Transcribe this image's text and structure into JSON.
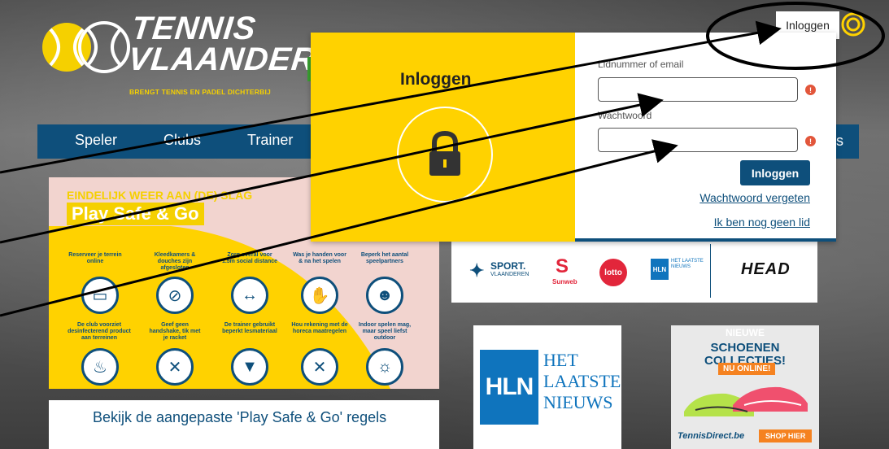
{
  "site": {
    "logo_line1": "TENNIS",
    "logo_line2": "VLAANDEREN",
    "tagline": "BRENGT TENNIS EN PADEL DICHTERBIJ"
  },
  "nav": {
    "items": [
      "Speler",
      "Clubs",
      "Trainer"
    ],
    "right_fragment": "s"
  },
  "header": {
    "login_label": "Inloggen"
  },
  "modal": {
    "title": "Inloggen",
    "field1_label": "Lidnummer of email",
    "field2_label": "Wachtwoord",
    "submit_label": "Inloggen",
    "forgot_link": "Wachtwoord vergeten",
    "not_member_link": "Ik ben nog geen lid",
    "error_glyph": "!"
  },
  "banner": {
    "heading": "EINDELIJK WEER AAN (DE) SLAG",
    "title": "Play Safe & Go",
    "rules": [
      {
        "text": "Reserveer je terrein online",
        "icon": "monitor-icon"
      },
      {
        "text": "Kleedkamers & douches zijn afgesloten",
        "icon": "shower-icon"
      },
      {
        "text": "Zorg overal voor 1.5m social distance",
        "icon": "distance-icon"
      },
      {
        "text": "Was je handen voor & na het spelen",
        "icon": "hands-icon"
      },
      {
        "text": "Beperk het aantal speelpartners",
        "icon": "people-icon"
      },
      {
        "text": "De club voorziet desinfecterend product aan terreinen",
        "icon": "spray-icon"
      },
      {
        "text": "Geef geen handshake, tik met je racket",
        "icon": "racket-icon"
      },
      {
        "text": "De trainer gebruikt beperkt lesmateriaal",
        "icon": "basket-icon"
      },
      {
        "text": "Hou rekening met de horeca maatregelen",
        "icon": "cutlery-icon"
      },
      {
        "text": "Indoor spelen mag, maar speel liefst outdoor",
        "icon": "sun-court-icon"
      }
    ],
    "bottom_title": "Bekijk de aangepaste 'Play Safe & Go' regels"
  },
  "sponsors": {
    "sport_line1": "SPORT.",
    "sport_line2": "VLAANDEREN",
    "sunweb": "Sunweb",
    "lotto": "lotto",
    "hln_small": "HLN",
    "hln_small_text": "HET LAATSTE NIEUWS",
    "head": "HEAD"
  },
  "ads": {
    "hln_logo": "HLN",
    "hln_line1": "HET",
    "hln_line2": "LAATSTE",
    "hln_line3": "NIEUWS",
    "shoe_new": "NIEUWE",
    "shoe_title": "SCHOENEN COLLECTIES!",
    "shoe_badge": "NU ONLINE!",
    "shoe_brand": "TennisDirect.be",
    "shoe_shop": "SHOP HIER"
  },
  "colors": {
    "brand_blue": "#0e4f7b",
    "brand_yellow": "#ffd200",
    "error_red": "#e2563b"
  }
}
